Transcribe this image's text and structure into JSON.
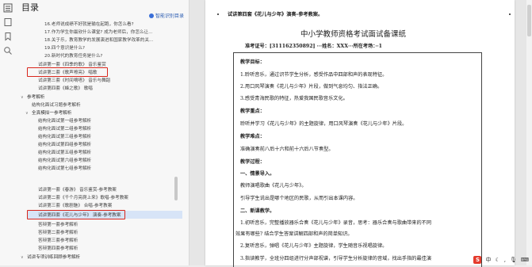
{
  "toc": {
    "title": "目录",
    "smart_label": "智能识别目录",
    "items": [
      "16.老师说成绩不好就是输在起跑，你怎么看?",
      "17.作为学生你最欣什么课堂? 成为老师后，你怎么让...",
      "18.关于乐，教育教学的发展演进和国家教学改革的关...",
      "19.四个意识是什么?",
      "20.新时代的教育任务是什么?",
      "试讲第一套《四季的歌》 音乐鉴赏",
      "试讲第二套《歌声嘹亮》 唱歌",
      "试讲第三套《时间嘀嗒》 音乐与舞蹈",
      "试讲第四套《蜂之歌》 歌唱",
      "参考解析",
      "结构化面试习题参考解析",
      "全真模拟一参考解析",
      "结构化面试第一组参考解析",
      "结构化面试第二组参考解析",
      "结构化面试第三组参考解析",
      "结构化面试第四组参考解析",
      "结构化面试第五组参考解析",
      "结构化面试第六组参考解析",
      "结构化面试第七组参考解析",
      "试讲第一套《春游》 音乐鉴赏-参考教案",
      "试讲第二套《千个月亮爬上来》歌唱-参考教案",
      "试讲第三套《歌剧魅》 合唱-参考教案",
      "试讲第四套《花儿与少年》 演奏-参考教案",
      "答辩第一套参考解析",
      "答辩第二套参考解析",
      "答辩第三套参考解析",
      "答辩第四套参考解析",
      "试讲专项训练回顾参考解析"
    ]
  },
  "document": {
    "heading_line": "试讲第四套《花儿与少年》演奏-参考教案。",
    "exam_title": "中小学教师资格考试面试备课纸",
    "candidate_line": "准考证号：[311162350892] ···姓名：XXX···所在考场：··1",
    "sections": [
      "教学目标：",
      "1.聆听音乐，通过识节学生分析，感受作品中四部和声的表现特征。",
      "2.用口风琴演奏《花儿与少年》片段，做到气息均匀、指法正确。",
      "3.感受青海民歌的特征，热爱我国民歌音乐文化。",
      "教学重点：",
      "聆听并学习《花儿与少年》的主题旋律，用口风琴演奏《花儿与少年》片段。",
      "教学难点：",
      "准确演奏前八后十六和前十六后八节奏型。",
      "教学过程：",
      "一、情景导入。",
      "教师演唱歌曲《花儿与少年》。",
      "引导学生说出是哪个地区的民歌，从而引出本课内容。",
      "二、新课教学。",
      "1.初听音乐，完整播放器乐合奏《花儿与少年》录音，思考：器乐合奏与歌曲带来的不同",
      "效果有哪些? 结合学生答案讲解四部和声的简单知识。",
      "2.复听音乐，弹唱《花儿与少年》主题旋律，学生随音乐视唱旋律。",
      "3.指读教学，全班分四组进行分声部视谱，引导学生分析旋律的音域，找出手指的最佳演"
    ]
  },
  "footer": {
    "logo_text": "S",
    "ime_label": "中",
    "icons": [
      "moon-icon",
      "comma-icon",
      "mic-icon",
      "keyboard-icon"
    ]
  }
}
